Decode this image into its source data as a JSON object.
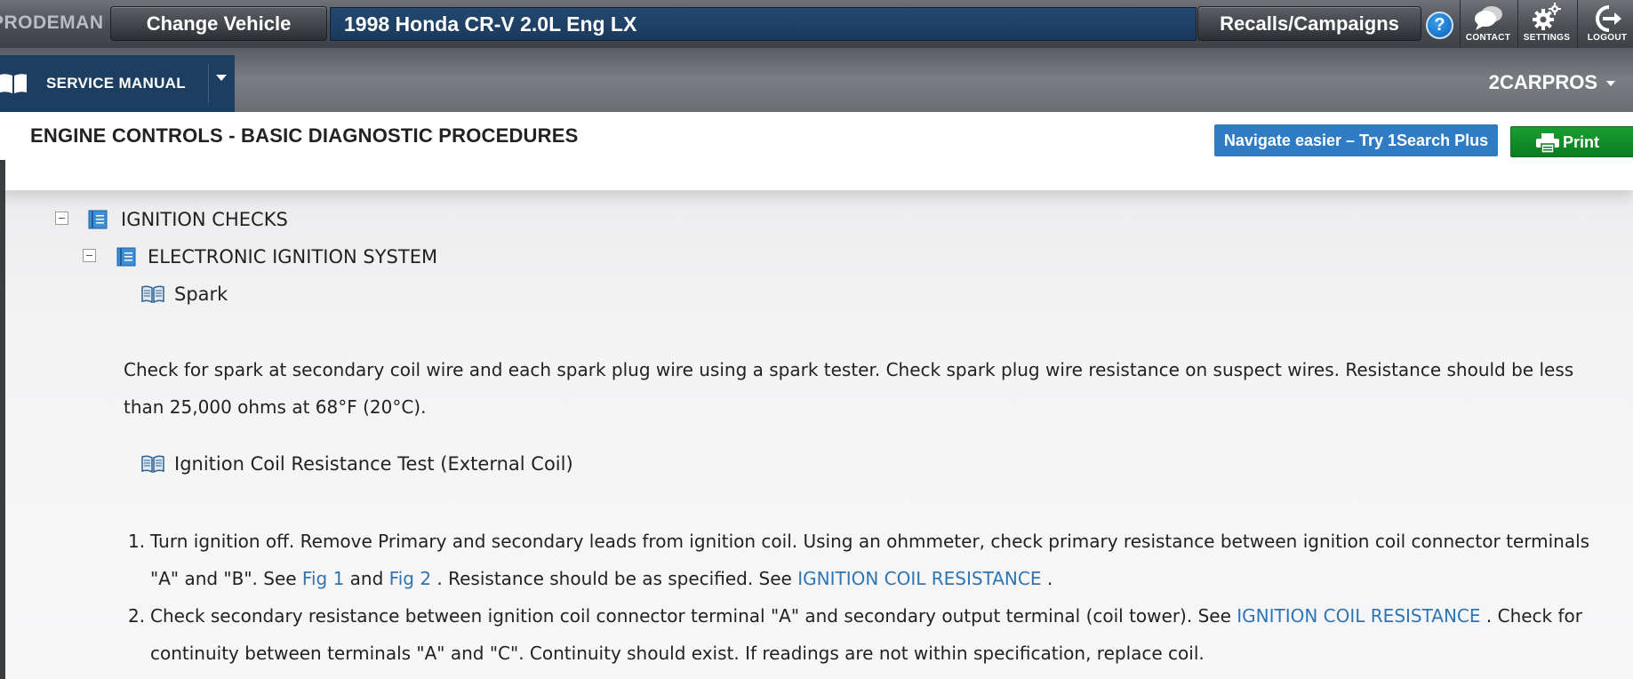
{
  "topbar": {
    "brand": "PRODEMAND",
    "change_vehicle": "Change Vehicle",
    "vehicle": "1998 Honda CR-V 2.0L Eng LX",
    "recalls": "Recalls/Campaigns",
    "help": "?",
    "contact": "CONTACT",
    "settings": "SETTINGS",
    "logout": "LOGOUT"
  },
  "navbar": {
    "module": "SERVICE MANUAL",
    "account": "2CARPROS"
  },
  "header": {
    "title": "ENGINE CONTROLS - BASIC DIAGNOSTIC PROCEDURES",
    "try_button": "Navigate easier – Try 1Search Plus",
    "print_button": "Print"
  },
  "tree": {
    "level1": "IGNITION CHECKS",
    "level2": "ELECTRONIC IGNITION SYSTEM",
    "level3": "Spark"
  },
  "content": {
    "spark_text": "Check for spark at secondary coil wire and each spark plug wire using a spark tester. Check spark plug wire resistance on suspect wires. Resistance should be less than 25,000 ohms at 68°F (20°C).",
    "coil_heading": "Ignition Coil Resistance Test (External Coil)",
    "step1": {
      "num": "1.",
      "text_a": "Turn ignition off. Remove Primary and secondary leads from ignition coil. Using an ohmmeter, check primary resistance between ignition coil connector terminals \"A\" and \"B\". See ",
      "link_fig1": "Fig 1",
      "text_and": " and ",
      "link_fig2": "Fig 2",
      "text_b": " . Resistance should be as specified. See ",
      "link_resistance": "IGNITION COIL RESISTANCE",
      "text_c": " ."
    },
    "step2": {
      "num": "2.",
      "text_a": "Check secondary resistance between ignition coil connector terminal \"A\" and secondary output terminal (coil tower). See ",
      "link_resistance": "IGNITION COIL RESISTANCE",
      "text_b": " . Check for continuity between terminals \"A\" and \"C\". Continuity should exist. If readings are not within specification, replace coil."
    }
  },
  "colors": {
    "vehicle_bar": "#1a3a5c",
    "service_manual_bg": "#1c3e60",
    "try_button": "#2f7bc4",
    "print_button": "#138a2a",
    "link": "#2e75b6"
  }
}
